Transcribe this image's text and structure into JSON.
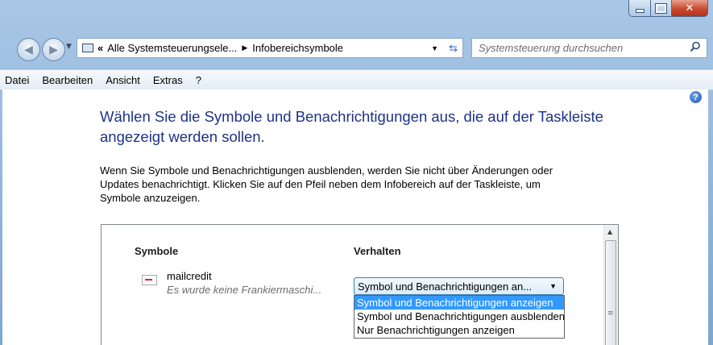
{
  "address": {
    "segment1": "Alle Systemsteuerungsele...",
    "segment2": "Infobereichsymbole"
  },
  "search": {
    "placeholder": "Systemsteuerung durchsuchen"
  },
  "menu": [
    "Datei",
    "Bearbeiten",
    "Ansicht",
    "Extras",
    "?"
  ],
  "heading_line1": "Wählen Sie die Symbole und Benachrichtigungen aus, die auf der Taskleiste",
  "heading_line2": "angezeigt werden sollen.",
  "description_line1": "Wenn Sie Symbole und Benachrichtigungen ausblenden, werden Sie nicht über Änderungen oder",
  "description_line2": "Updates benachrichtigt. Klicken Sie auf den Pfeil neben dem Infobereich auf der Taskleiste, um",
  "description_line3": "Symbole anzuzeigen.",
  "table": {
    "col_symbols": "Symbole",
    "col_behavior": "Verhalten",
    "rows": [
      {
        "name": "mailcredit",
        "description": "Es wurde keine Frankiermaschi...",
        "behavior": "Symbol und Benachrichtigungen an..."
      }
    ]
  },
  "dropdown_options": [
    "Symbol und Benachrichtigungen anzeigen",
    "Symbol und Benachrichtigungen ausblenden",
    "Nur Benachrichtigungen anzeigen"
  ],
  "colors": {
    "heading": "#1e3287",
    "selection": "#3399ff",
    "close": "#c74b2e"
  }
}
